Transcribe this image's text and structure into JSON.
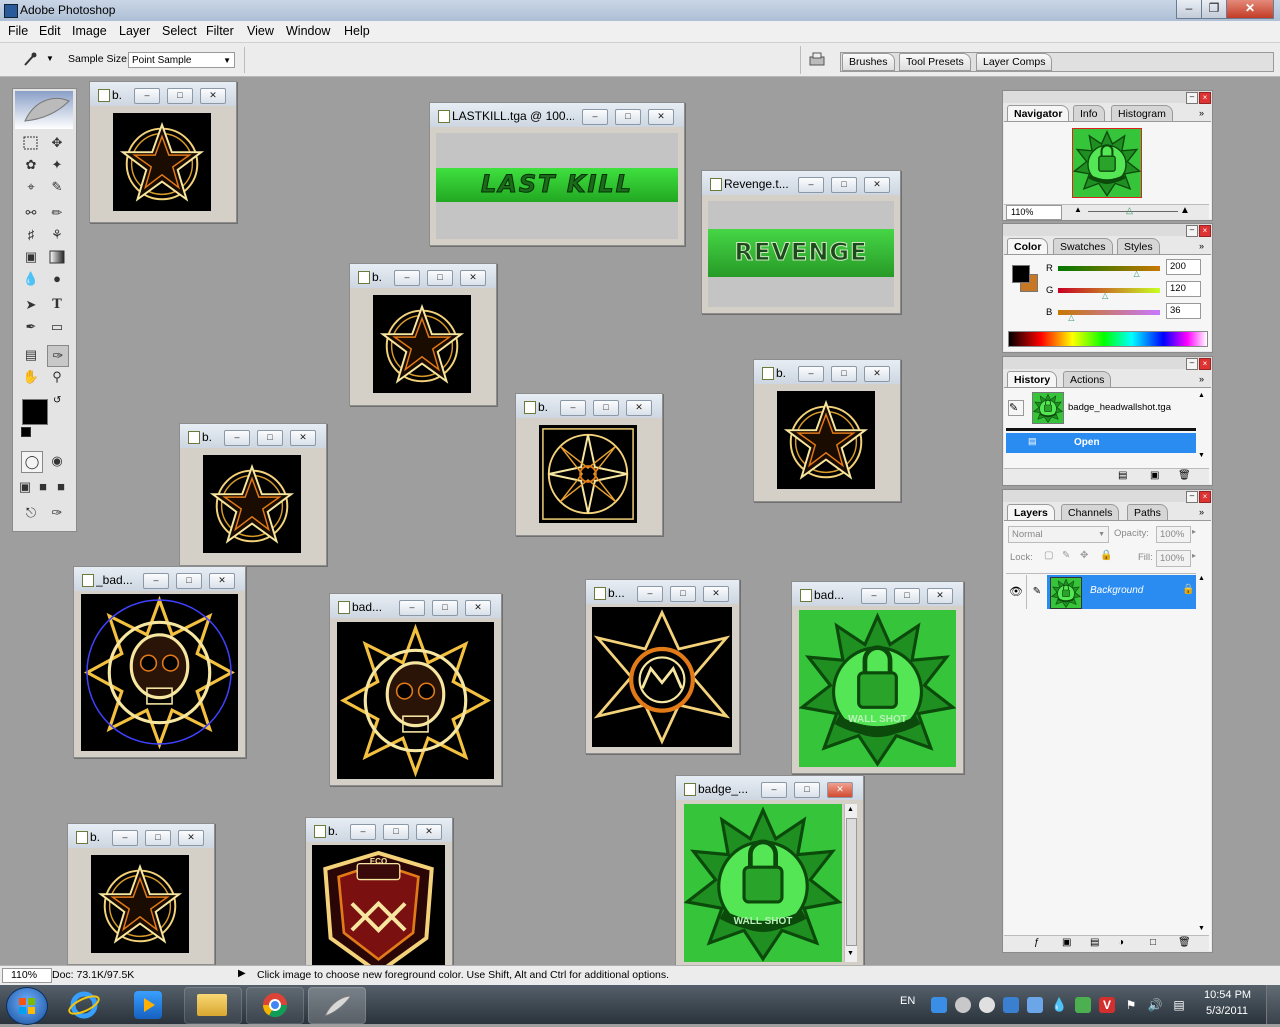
{
  "app": {
    "title": "Adobe Photoshop"
  },
  "menu": [
    "File",
    "Edit",
    "Image",
    "Layer",
    "Select",
    "Filter",
    "View",
    "Window",
    "Help"
  ],
  "options": {
    "sample_size_label": "Sample Size:",
    "sample_size_value": "Point Sample",
    "well_tabs": [
      "Brushes",
      "Tool Presets",
      "Layer Comps"
    ]
  },
  "documents": [
    {
      "title": "b."
    },
    {
      "title": "LASTKILL.tga @ 100..."
    },
    {
      "title": "Revenge.t..."
    },
    {
      "title": "b."
    },
    {
      "title": "b."
    },
    {
      "title": "b."
    },
    {
      "title": "b."
    },
    {
      "title": "_bad..."
    },
    {
      "title": "bad..."
    },
    {
      "title": "b..."
    },
    {
      "title": "bad..."
    },
    {
      "title": "badge_..."
    },
    {
      "title": "b."
    },
    {
      "title": "b."
    }
  ],
  "art_text": {
    "lastkill": "LAST KILL",
    "revenge": "REVENGE",
    "wallshot": "WALL SHOT",
    "shield": "ECO"
  },
  "navigator": {
    "tabs": [
      "Navigator",
      "Info",
      "Histogram"
    ],
    "zoom": "110%"
  },
  "color": {
    "tabs": [
      "Color",
      "Swatches",
      "Styles"
    ],
    "r_label": "R",
    "g_label": "G",
    "b_label": "B",
    "r": "200",
    "g": "120",
    "b": "36",
    "r_fraction": 0.78,
    "g_fraction": 0.47,
    "b_fraction": 0.14,
    "foreground": "#000000",
    "background": "#c87824"
  },
  "history": {
    "tabs": [
      "History",
      "Actions"
    ],
    "snapshot": "badge_headwallshot.tga",
    "item": "Open"
  },
  "layers": {
    "tabs": [
      "Layers",
      "Channels",
      "Paths"
    ],
    "blend_mode": "Normal",
    "opacity_label": "Opacity:",
    "opacity": "100%",
    "lock_label": "Lock:",
    "fill_label": "Fill:",
    "fill": "100%",
    "layer_name": "Background"
  },
  "status": {
    "zoom": "110%",
    "doc": "Doc: 73.1K/97.5K",
    "hint": "Click image to choose new foreground color.  Use Shift, Alt and Ctrl for additional options."
  },
  "taskbar": {
    "lang": "EN",
    "time": "10:54 PM",
    "date": "5/3/2011"
  }
}
